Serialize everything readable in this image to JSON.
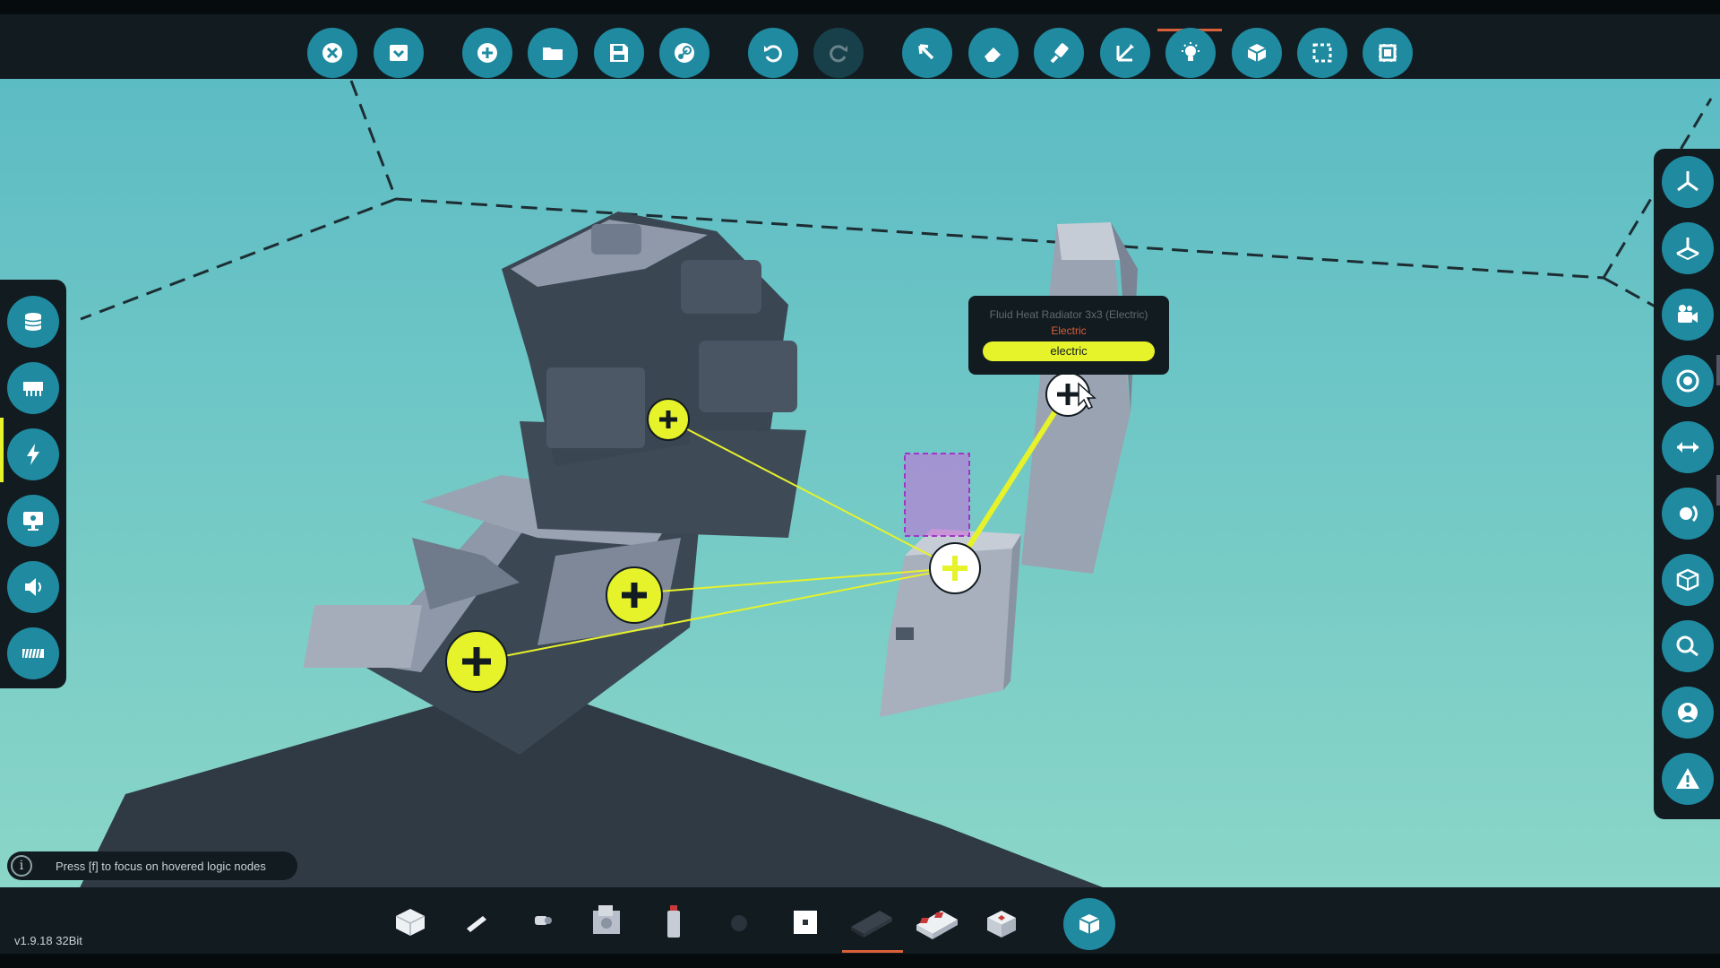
{
  "app": {
    "version": "v1.9.18 32Bit"
  },
  "colors": {
    "background": "#67c2c6",
    "panel": "#121b20",
    "button": "#1f8aa0",
    "accent_yellow": "#e6f22a",
    "accent_orange": "#d9603b",
    "logic_selection": "#c86ad8"
  },
  "toolbar": {
    "buttons": [
      {
        "name": "close-button",
        "icon": "close-icon"
      },
      {
        "name": "save-menu-button",
        "icon": "save-down-icon"
      },
      {
        "name": "new-button",
        "icon": "add-icon"
      },
      {
        "name": "open-button",
        "icon": "folder-icon"
      },
      {
        "name": "save-button",
        "icon": "floppy-icon"
      },
      {
        "name": "workshop-button",
        "icon": "steam-icon"
      },
      {
        "name": "undo-button",
        "icon": "undo-icon"
      },
      {
        "name": "redo-button",
        "icon": "redo-icon",
        "disabled": true
      },
      {
        "name": "select-tool-button",
        "icon": "cursor-icon"
      },
      {
        "name": "erase-tool-button",
        "icon": "eraser-icon"
      },
      {
        "name": "paint-tool-button",
        "icon": "paint-icon"
      },
      {
        "name": "transform-tool-button",
        "icon": "axis-icon"
      },
      {
        "name": "light-tool-button",
        "icon": "bulb-icon"
      },
      {
        "name": "block-tool-button",
        "icon": "cube-icon"
      },
      {
        "name": "box-select-button",
        "icon": "selection-icon"
      },
      {
        "name": "microcontroller-button",
        "icon": "chip-icon"
      }
    ]
  },
  "left_panel": {
    "buttons": [
      {
        "name": "layer-inventory-button",
        "icon": "database-icon"
      },
      {
        "name": "layer-logic-button",
        "icon": "chipboard-icon"
      },
      {
        "name": "layer-electric-button",
        "icon": "lightning-icon",
        "active": true
      },
      {
        "name": "layer-display-button",
        "icon": "monitor-icon"
      },
      {
        "name": "layer-audio-button",
        "icon": "speaker-icon"
      },
      {
        "name": "layer-grid-button",
        "icon": "grid-icon"
      }
    ]
  },
  "right_panel": {
    "buttons": [
      {
        "name": "view-axis-button",
        "icon": "axis-tri-icon"
      },
      {
        "name": "view-axis-alt-button",
        "icon": "axis-tri-alt-icon"
      },
      {
        "name": "camera-button",
        "icon": "camera-icon"
      },
      {
        "name": "center-button",
        "icon": "target-icon"
      },
      {
        "name": "move-button",
        "icon": "arrows-icon"
      },
      {
        "name": "rotate-button",
        "icon": "rotate-icon"
      },
      {
        "name": "block-view-button",
        "icon": "box-icon"
      },
      {
        "name": "zoom-button",
        "icon": "magnify-icon"
      },
      {
        "name": "character-button",
        "icon": "person-icon"
      },
      {
        "name": "warning-button",
        "icon": "warning-icon"
      }
    ]
  },
  "tooltip": {
    "title": "Fluid Heat Radiator 3x3 (Electric)",
    "type": "Electric",
    "port": "electric"
  },
  "hint": {
    "text": "Press [f] to focus on hovered logic nodes"
  },
  "bottom_bar": {
    "items": [
      {
        "name": "block-white",
        "icon": "white-cube-icon"
      },
      {
        "name": "wedge-piece",
        "icon": "wedge-icon"
      },
      {
        "name": "pipe-piece",
        "icon": "pipe-icon"
      },
      {
        "name": "engine-piece",
        "icon": "engine-icon"
      },
      {
        "name": "canister-piece",
        "icon": "canister-icon"
      },
      {
        "name": "sphere-piece",
        "icon": "sphere-icon"
      },
      {
        "name": "frame-piece",
        "icon": "frame-icon"
      },
      {
        "name": "battery-piece",
        "icon": "battery-icon",
        "selected": true
      },
      {
        "name": "switch-block-piece",
        "icon": "switch-block-icon"
      },
      {
        "name": "button-block-piece",
        "icon": "button-block-icon"
      }
    ]
  }
}
